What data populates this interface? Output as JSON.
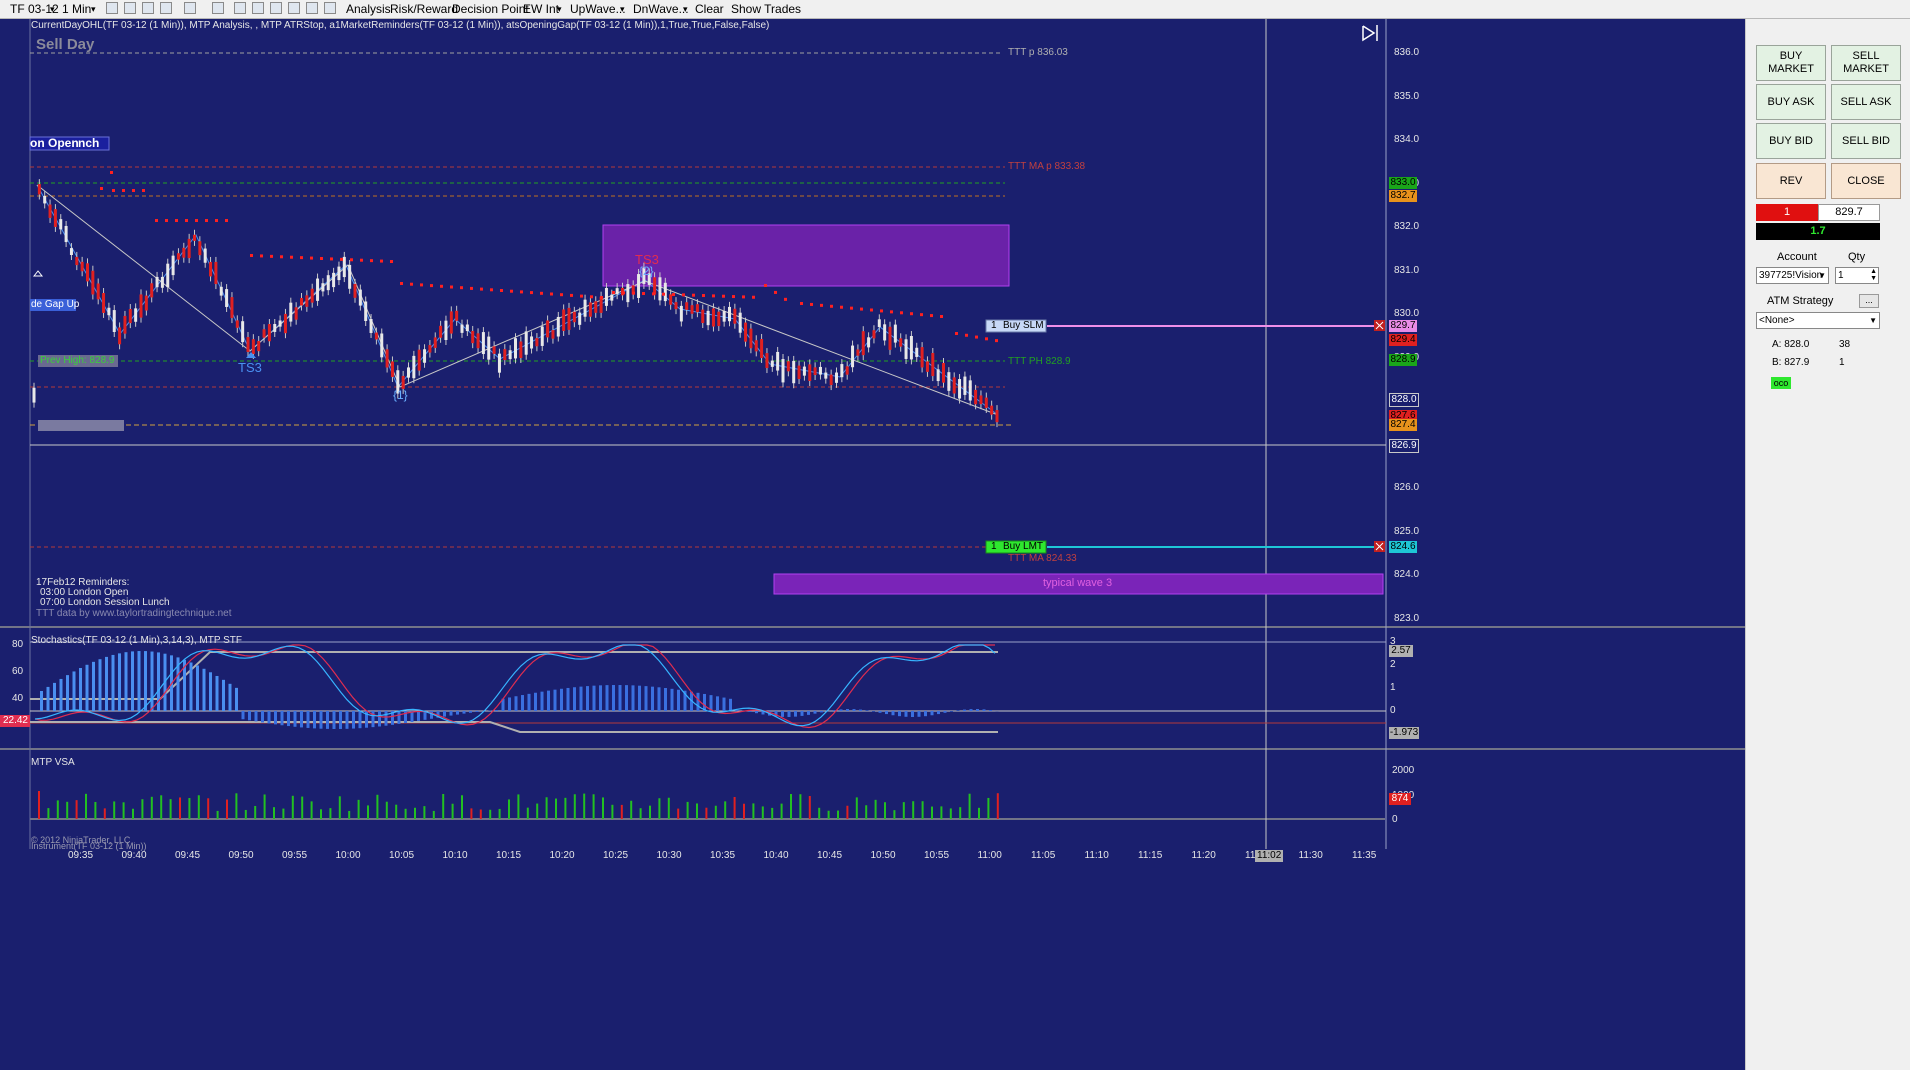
{
  "toolbar": {
    "instrument": "TF 03-12",
    "interval": "1 Min",
    "items": [
      "Analysis",
      "Risk/Reward",
      "Decision Point",
      "EW Int",
      "UpWave...",
      "DnWave...",
      "Clear",
      "Show Trades"
    ]
  },
  "chart": {
    "indicator_line": "CurrentDayOHL(TF 03-12 (1 Min)), MTP Analysis, , MTP ATRStop, a1MarketReminders(TF 03-12 (1 Min)), atsOpeningGap(TF 03-12 (1 Min)),1,True,True,False,False)",
    "sell_day": "Sell Day",
    "london_label": "on Open",
    "london_label2": "nch",
    "gap_up_label": "de Gap Up",
    "prev_high": "Prev High: 828.9",
    "ttt_p": "TTT p 836.03",
    "ttt_ma_p": "TTT MA p 833.38",
    "ttt_ph": "TTT PH 828.9",
    "ttt_ma": "TTT MA 824.33",
    "ts3_left": "TS3",
    "ts3_mid": "TS3",
    "wave2": "{2}",
    "wave1": "{1}",
    "typical_wave": "typical wave 3",
    "buy_slm": "Buy SLM",
    "buy_slm_qty": "1",
    "buy_lmt": "Buy LMT",
    "buy_lmt_qty": "1",
    "reminders": [
      "17Feb12 Reminders:",
      "03:00 London Open",
      "07:00 London Session Lunch"
    ],
    "ttt_data": "TTT data by www.taylortradingtechnique.net",
    "price_axis": [
      "836.0",
      "835.0",
      "834.0",
      "833.0",
      "832.0",
      "831.0",
      "830.0",
      "829.0",
      "828.0",
      "827.0",
      "826.0",
      "825.0",
      "824.0",
      "823.0"
    ],
    "price_tags": [
      {
        "text": "833.0",
        "color": "#1aa51a"
      },
      {
        "text": "832.7",
        "color": "#e8921c"
      },
      {
        "text": "829.7",
        "color": "#e98be6"
      },
      {
        "text": "829.4",
        "color": "#e02020"
      },
      {
        "text": "828.9",
        "color": "#1aa51a"
      },
      {
        "text": "828.0",
        "color": "#1a1f6e"
      },
      {
        "text": "827.6",
        "color": "#e02020"
      },
      {
        "text": "827.4",
        "color": "#e8921c"
      },
      {
        "text": "826.9",
        "color": "#1a1f6e"
      },
      {
        "text": "824.6",
        "color": "#1ec6d6"
      }
    ],
    "stoch_title": "Stochastics(TF 03-12 (1 Min),3,14,3), MTP STF",
    "stoch_left_axis": [
      "80",
      "60",
      "40"
    ],
    "stoch_value_tag": "22.42",
    "stoch_right_axis": [
      "3",
      "2",
      "1",
      "0",
      "-1"
    ],
    "stoch_tags": [
      "2.57",
      "-1.973"
    ],
    "vsa_title": "MTP VSA",
    "vsa_axis": [
      "2000",
      "1000",
      "0"
    ],
    "vsa_tag": "874",
    "time_axis": [
      "09:35",
      "09:40",
      "09:45",
      "09:50",
      "09:55",
      "10:00",
      "10:05",
      "10:10",
      "10:15",
      "10:20",
      "10:25",
      "10:30",
      "10:35",
      "10:40",
      "10:45",
      "10:50",
      "10:55",
      "11:00",
      "11:05",
      "11:10",
      "11:15",
      "11:20",
      "11:25",
      "11:30",
      "11:35"
    ],
    "crosshair_time": "11:02",
    "copyright": "© 2012 NinjaTrader, LLC",
    "footer_series": "Instrument(TF 03-12 (1 Min))"
  },
  "panel": {
    "buttons": {
      "buy_market": "BUY MARKET",
      "sell_market": "SELL MARKET",
      "buy_ask": "BUY ASK",
      "sell_ask": "SELL ASK",
      "buy_bid": "BUY BID",
      "sell_bid": "SELL BID",
      "rev": "REV",
      "close": "CLOSE"
    },
    "position_qty": "1",
    "position_price": "829.7",
    "pnl": "1.7",
    "account_label": "Account",
    "qty_label": "Qty",
    "account_value": "397725!Vision",
    "qty_value": "1",
    "atm_label": "ATM Strategy",
    "atm_value": "<None>",
    "atm_more": "...",
    "ask_label": "A: 828.0",
    "ask_size": "38",
    "bid_label": "B: 827.9",
    "bid_size": "1",
    "oco": "oco"
  },
  "colors": {
    "background": "#1a1f6e",
    "up_candle": "#4a8ff0",
    "down_candle": "#e02020",
    "zigzag": "#c8c8c8",
    "stoch_fast": "#e02d50",
    "stoch_slow": "#37b4ff",
    "panel_bg": "#f0f0f0"
  }
}
